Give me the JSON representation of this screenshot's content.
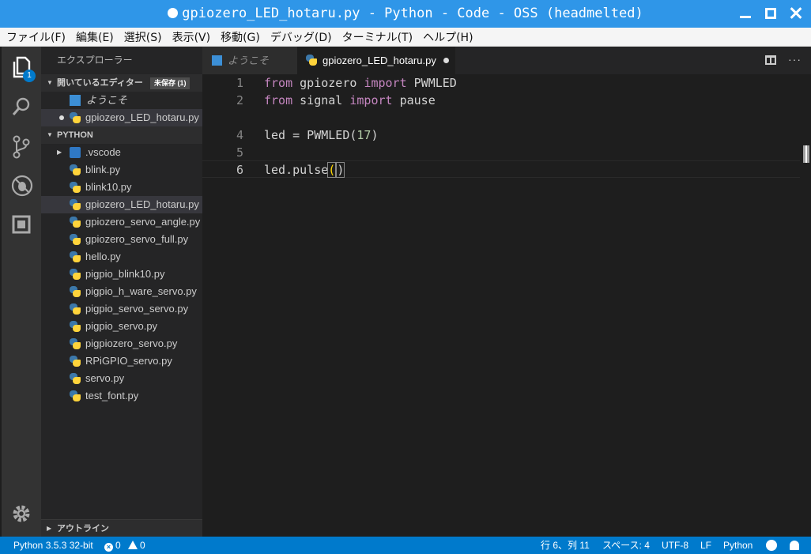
{
  "window": {
    "title": "gpiozero_LED_hotaru.py - Python - Code - OSS (headmelted)"
  },
  "menu": [
    "ファイル(F)",
    "編集(E)",
    "選択(S)",
    "表示(V)",
    "移動(G)",
    "デバッグ(D)",
    "ターミナル(T)",
    "ヘルプ(H)"
  ],
  "activity": {
    "explorer_badge": "1"
  },
  "sidebar": {
    "title": "エクスプローラー",
    "open_editors": {
      "header": "開いているエディター",
      "unsaved_tag": "未保存 (1)",
      "items": [
        "ようこそ",
        "gpiozero_LED_hotaru.py"
      ]
    },
    "folder": {
      "header": "PYTHON",
      "items": [
        ".vscode",
        "blink.py",
        "blink10.py",
        "gpiozero_LED_hotaru.py",
        "gpiozero_servo_angle.py",
        "gpiozero_servo_full.py",
        "hello.py",
        "pigpio_blink10.py",
        "pigpio_h_ware_servo.py",
        "pigpio_servo_servo.py",
        "pigpio_servo.py",
        "pigpiozero_servo.py",
        "RPiGPIO_servo.py",
        "servo.py",
        "test_font.py"
      ]
    },
    "outline": "アウトライン"
  },
  "tabs": [
    {
      "label": "ようこそ"
    },
    {
      "label": "gpiozero_LED_hotaru.py"
    }
  ],
  "editor": {
    "line_numbers": [
      "1",
      "2",
      "4",
      "5",
      "6"
    ],
    "lines": {
      "l1": {
        "kw1": "from",
        "t1": " gpiozero ",
        "kw2": "import",
        "t2": " PWMLED"
      },
      "l2": {
        "kw1": "from",
        "t1": " signal ",
        "kw2": "import",
        "t2": " pause"
      },
      "l4": {
        "t1": "led = PWMLED(",
        "num": "17",
        "t2": ")"
      },
      "l6": {
        "t1": "led.pulse",
        "p1": "(",
        "p2": ")"
      }
    }
  },
  "status": {
    "interpreter": "Python 3.5.3 32-bit",
    "errors": "0",
    "warnings": "0",
    "position": "行 6、列 11",
    "spaces": "スペース: 4",
    "encoding": "UTF-8",
    "eol": "LF",
    "language": "Python"
  }
}
